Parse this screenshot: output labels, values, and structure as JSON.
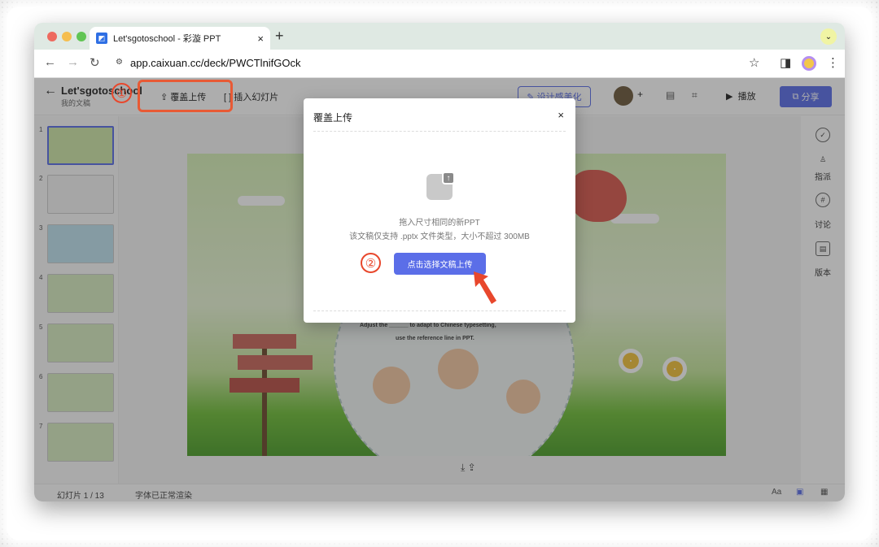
{
  "browser": {
    "tab_title": "Let'sgotoschool - 彩漩 PPT",
    "tab_close": "×",
    "new_tab": "+",
    "url": "app.caixuan.cc/deck/PWCTlnifGOck"
  },
  "app": {
    "doc_title": "Let'sgotoschool",
    "doc_subtitle": "我的文稿",
    "cover_upload": "覆盖上传",
    "insert_slide": "插入幻灯片",
    "beautify": "设计感美化",
    "play": "播放",
    "share": "分享"
  },
  "sidebar": {
    "slides": [
      {
        "num": "1",
        "color": "#cfe7a8"
      },
      {
        "num": "2",
        "color": "#f4f4f4"
      },
      {
        "num": "3",
        "color": "#bfe3ef"
      },
      {
        "num": "4",
        "color": "#d7ecc0"
      },
      {
        "num": "5",
        "color": "#d7ecc0"
      },
      {
        "num": "6",
        "color": "#d7ecc0"
      },
      {
        "num": "7",
        "color": "#d7ecc0"
      }
    ]
  },
  "slide": {
    "line1": "Adjust the ______ to adapt to Chinese  typesetting,",
    "line2": "use the reference line in PPT."
  },
  "right_panel": {
    "assign": "指派",
    "discuss": "讨论",
    "version": "版本"
  },
  "status": {
    "slide_count": "幻灯片 1 / 13",
    "font_status": "字体已正常渲染"
  },
  "modal": {
    "title": "覆盖上传",
    "close": "×",
    "hint_line1": "拖入尺寸相同的新PPT",
    "hint_line2": "该文稿仅支持 .pptx 文件类型，大小不超过 300MB",
    "choose_button": "点击选择文稿上传"
  },
  "annotations": {
    "step1": "①",
    "step2": "②"
  },
  "colors": {
    "accent": "#5b6ee8",
    "highlight": "#e8472c"
  }
}
